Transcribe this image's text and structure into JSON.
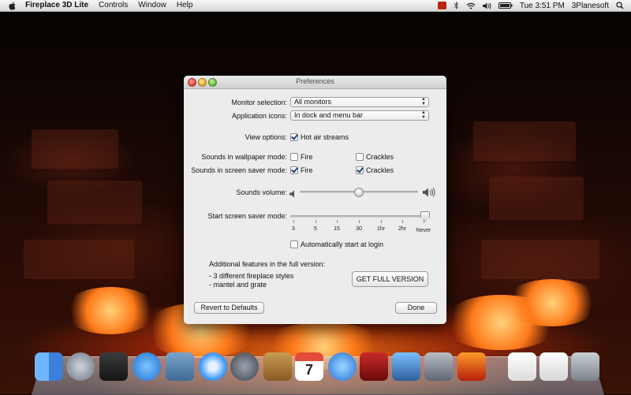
{
  "menubar": {
    "app_name": "Fireplace 3D Lite",
    "menus": [
      "Controls",
      "Window",
      "Help"
    ],
    "clock": "Tue 3:51 PM",
    "user": "3Planesoft"
  },
  "window": {
    "title": "Preferences",
    "monitor_selection": {
      "label": "Monitor selection:",
      "value": "All monitors"
    },
    "application_icons": {
      "label": "Application icons:",
      "value": "In dock and menu bar"
    },
    "view_options": {
      "label": "View options:",
      "hot_air_streams": {
        "label": "Hot air streams",
        "checked": true
      }
    },
    "sounds_wallpaper": {
      "label": "Sounds in wallpaper mode:",
      "fire": {
        "label": "Fire",
        "checked": false
      },
      "crackles": {
        "label": "Crackles",
        "checked": false
      }
    },
    "sounds_screensaver": {
      "label": "Sounds in screen saver mode:",
      "fire": {
        "label": "Fire",
        "checked": true
      },
      "crackles": {
        "label": "Crackles",
        "checked": true
      }
    },
    "sounds_volume": {
      "label": "Sounds volume:",
      "value_fraction": 0.5
    },
    "screen_saver_mode": {
      "label": "Start screen saver mode:",
      "ticks": [
        "3",
        "5",
        "15",
        "30",
        "1hr",
        "2hr",
        "Never"
      ],
      "selected": "Never"
    },
    "auto_start": {
      "label": "Automatically start at login",
      "checked": false
    },
    "full_version": {
      "heading": "Additional features in the full version:",
      "features": [
        "- 3 different fireplace styles",
        "- mantel and grate"
      ],
      "button": "GET FULL VERSION"
    },
    "revert_button": "Revert to Defaults",
    "done_button": "Done"
  },
  "dock": {
    "icons": [
      "finder-icon",
      "launchpad-icon",
      "dashboard-icon",
      "app-store-icon",
      "mail-icon",
      "safari-icon",
      "facetime-icon",
      "address-book-icon",
      "calendar-icon",
      "itunes-icon",
      "photo-booth-icon",
      "iphoto-icon",
      "system-preferences-icon",
      "fireplace-lite-icon",
      "document-icon",
      "document-icon-2",
      "trash-icon"
    ],
    "calendar_day": "7"
  },
  "colors": {
    "accent": "#1e3e80",
    "fire": "#ff7a1a"
  }
}
